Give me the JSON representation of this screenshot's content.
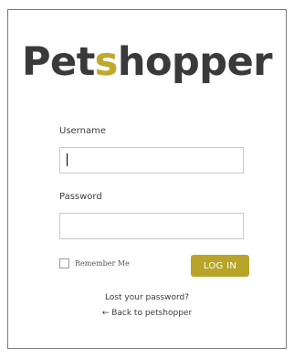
{
  "logo": {
    "part1": "Pet",
    "highlight": "s",
    "part2": "hopper",
    "accent_color": "#bfa92a"
  },
  "form": {
    "username_label": "Username",
    "username_value": "",
    "password_label": "Password",
    "password_value": "",
    "remember_label": "Remember Me",
    "remember_checked": false,
    "login_label": "LOG IN",
    "button_color": "#b8a428"
  },
  "links": {
    "lost_password": "Lost your password?",
    "back_to_site": "← Back to petshopper"
  }
}
